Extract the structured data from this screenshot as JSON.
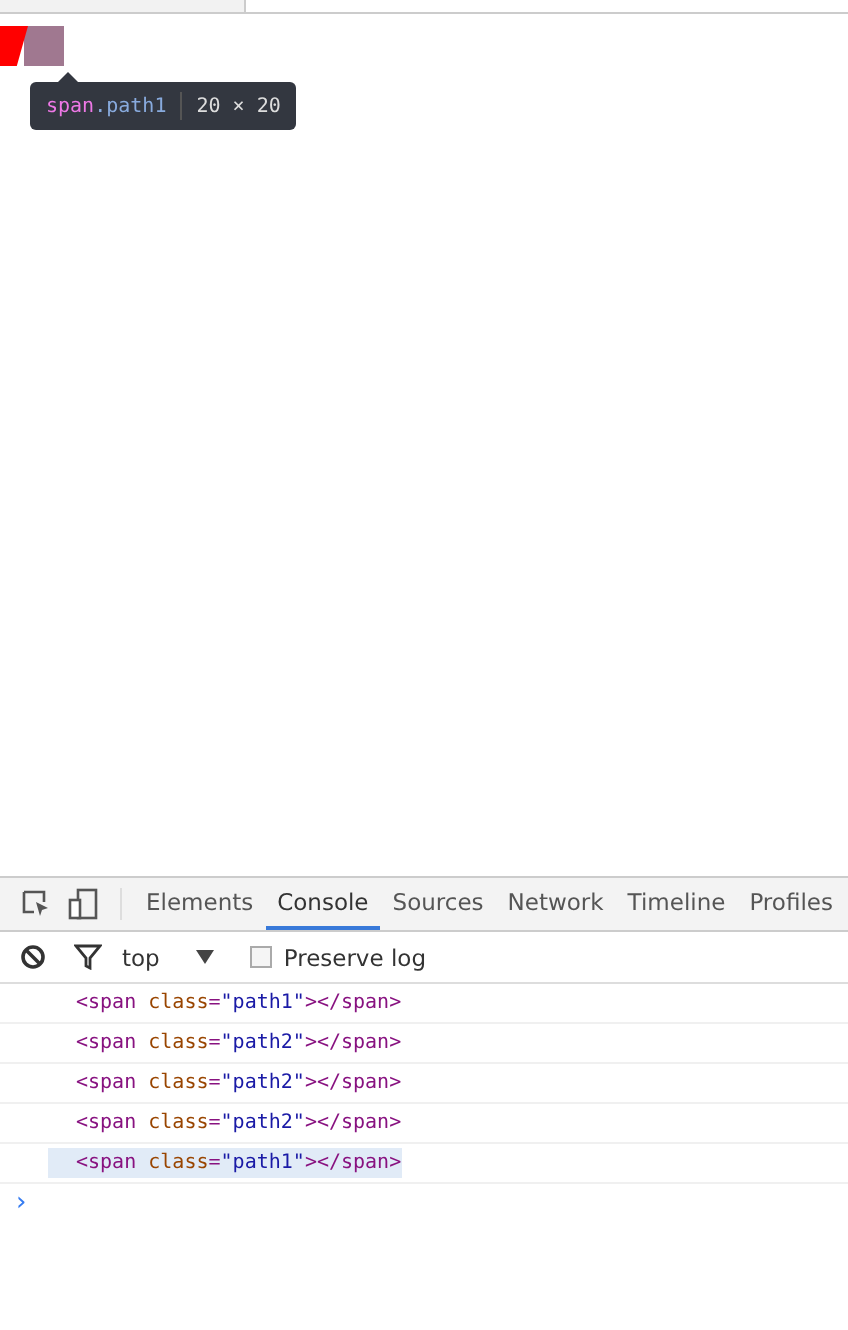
{
  "inspect_tooltip": {
    "tag": "span",
    "class_name": ".path1",
    "size": "20 × 20"
  },
  "devtools": {
    "tabs": [
      {
        "label": "Elements",
        "selected": false
      },
      {
        "label": "Console",
        "selected": true
      },
      {
        "label": "Sources",
        "selected": false
      },
      {
        "label": "Network",
        "selected": false
      },
      {
        "label": "Timeline",
        "selected": false
      },
      {
        "label": "Profiles",
        "selected": false
      }
    ],
    "context": "top",
    "preserve_log": {
      "label": "Preserve log",
      "checked": false
    },
    "console_lines": [
      {
        "open": "<span",
        "attr": "class",
        "eq": "=",
        "value": "\"path1\"",
        "close": "></span>",
        "selected": false
      },
      {
        "open": "<span",
        "attr": "class",
        "eq": "=",
        "value": "\"path2\"",
        "close": "></span>",
        "selected": false
      },
      {
        "open": "<span",
        "attr": "class",
        "eq": "=",
        "value": "\"path2\"",
        "close": "></span>",
        "selected": false
      },
      {
        "open": "<span",
        "attr": "class",
        "eq": "=",
        "value": "\"path2\"",
        "close": "></span>",
        "selected": false
      },
      {
        "open": "<span",
        "attr": "class",
        "eq": "=",
        "value": "\"path1\"",
        "close": "></span>",
        "selected": true
      }
    ],
    "prompt": "›"
  }
}
